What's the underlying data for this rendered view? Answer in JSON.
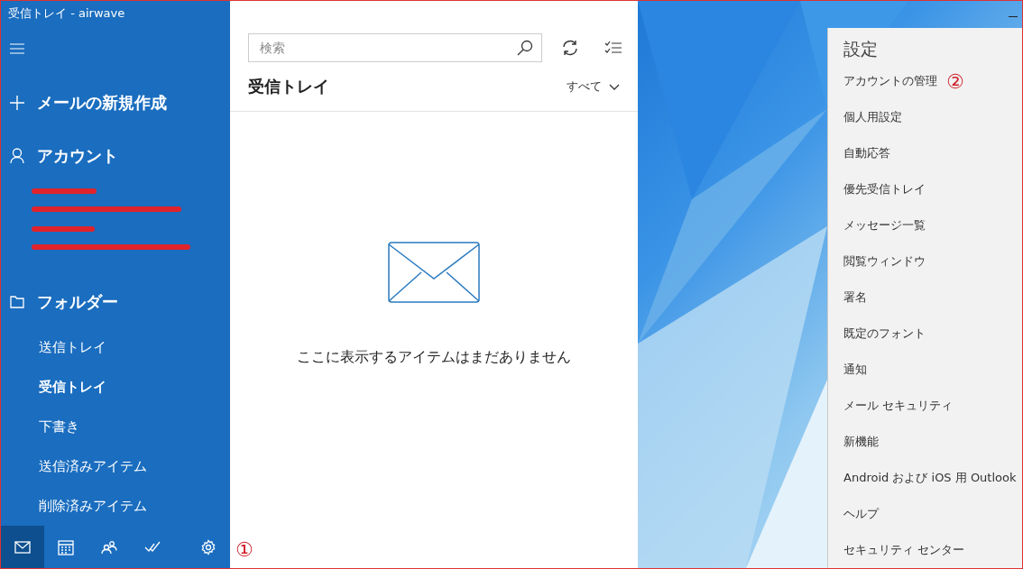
{
  "window": {
    "title": "受信トレイ - airwave"
  },
  "nav": {
    "new_mail": "メールの新規作成",
    "accounts_heading": "アカウント",
    "accounts": [
      {
        "redacted": true
      },
      {
        "redacted": true
      }
    ],
    "folders_heading": "フォルダー",
    "folders": [
      {
        "label": "送信トレイ",
        "selected": false
      },
      {
        "label": "受信トレイ",
        "selected": true
      },
      {
        "label": "下書き",
        "selected": false
      },
      {
        "label": "送信済みアイテム",
        "selected": false
      },
      {
        "label": "削除済みアイテム",
        "selected": false
      }
    ],
    "bottom_bar": [
      {
        "kind": "mail",
        "selected": true
      },
      {
        "kind": "calendar",
        "selected": false
      },
      {
        "kind": "people",
        "selected": false
      },
      {
        "kind": "todo",
        "selected": false
      },
      {
        "kind": "settings",
        "selected": false
      }
    ]
  },
  "message_list": {
    "search": {
      "placeholder": "検索"
    },
    "title": "受信トレイ",
    "filter": "すべて",
    "empty_message": "ここに表示するアイテムはまだありません",
    "annotation": "①"
  },
  "settings": {
    "title": "設定",
    "items": [
      {
        "label": "アカウントの管理",
        "annotation": "②"
      },
      {
        "label": "個人用設定"
      },
      {
        "label": "自動応答"
      },
      {
        "label": "優先受信トレイ"
      },
      {
        "label": "メッセージ一覧"
      },
      {
        "label": "閲覧ウィンドウ"
      },
      {
        "label": "署名"
      },
      {
        "label": "既定のフォント"
      },
      {
        "label": "通知"
      },
      {
        "label": "メール セキュリティ"
      },
      {
        "label": "新機能"
      },
      {
        "label": "Android および iOS 用 Outlook"
      },
      {
        "label": "ヘルプ"
      },
      {
        "label": "セキュリティ センター"
      }
    ]
  }
}
